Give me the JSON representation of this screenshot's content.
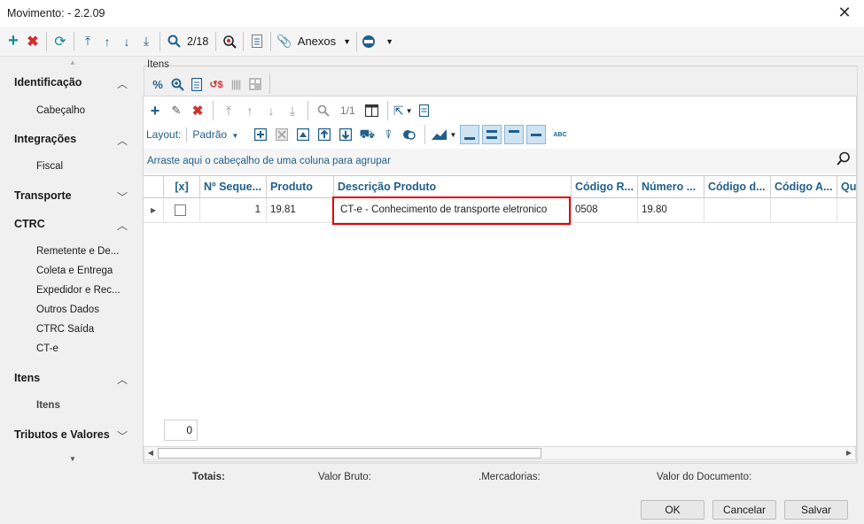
{
  "window": {
    "title": "Movimento:  - 2.2.09",
    "close_glyph": "✕"
  },
  "main_toolbar": {
    "record_counter": "2/18",
    "attachments_label": "Anexos"
  },
  "sidebar": {
    "sections": [
      {
        "label": "Identificação",
        "expanded": true,
        "items": [
          "Cabeçalho"
        ]
      },
      {
        "label": "Integrações",
        "expanded": true,
        "items": [
          "Fiscal"
        ]
      },
      {
        "label": "Transporte",
        "expanded": false,
        "items": []
      },
      {
        "label": "CTRC",
        "expanded": true,
        "items": [
          "Remetente e De...",
          "Coleta e Entrega",
          "Expedidor e Rec...",
          "Outros Dados",
          "CTRC Saída",
          "CT-e"
        ]
      },
      {
        "label": "Itens",
        "expanded": true,
        "items": [
          "Itens"
        ]
      },
      {
        "label": "Tributos e Valores",
        "expanded": false,
        "items": []
      }
    ]
  },
  "items_panel": {
    "group_label": "Itens",
    "page_counter": "1/1",
    "layout_label": "Layout:",
    "layout_value": "Padrão",
    "abc_label": "ABC",
    "group_hint": "Arraste aqui o cabeçalho de uma coluna para agrupar",
    "columns": [
      "[x]",
      "Nº Seque...",
      "Produto",
      "Descrição Produto",
      "Código R...",
      "Número ...",
      "Código d...",
      "Código A...",
      "Qu"
    ],
    "rows": [
      {
        "seq": "1",
        "produto": "19.81",
        "descricao": "CT-e - Conhecimento de transporte eletronico",
        "codigo_r": "0508",
        "numero": "19.80",
        "codigo_d": "",
        "codigo_a": "",
        "qu": ""
      }
    ],
    "footer_count": "0"
  },
  "totals": {
    "label": "Totais:",
    "valor_bruto": "Valor Bruto:",
    "mercadorias": ".Mercadorias:",
    "valor_documento": "Valor do Documento:"
  },
  "buttons": {
    "ok": "OK",
    "cancel": "Cancelar",
    "save": "Salvar"
  },
  "colors": {
    "accent": "#1f5f8b",
    "teal": "#118899",
    "delete": "#d32f2f",
    "highlight": "#e00000"
  }
}
